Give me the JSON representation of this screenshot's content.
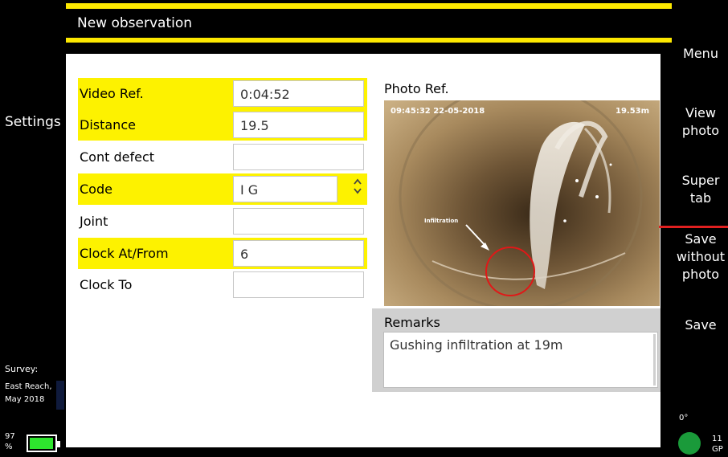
{
  "header": {
    "title": "New observation"
  },
  "left": {
    "settings_label": "Settings",
    "survey_label": "Survey:",
    "survey_name_line1": "East Reach,",
    "survey_name_line2": "May 2018",
    "battery_percent_line1": "97",
    "battery_percent_line2": "%",
    "battery_level": 0.97
  },
  "form": {
    "rows": [
      {
        "label": "Video Ref.",
        "value": "0:04:52",
        "highlighted": true
      },
      {
        "label": "Distance",
        "value": "19.5",
        "highlighted": true
      },
      {
        "label": "Cont defect",
        "value": "",
        "highlighted": false
      },
      {
        "label": "Code",
        "value": "I G",
        "highlighted": true
      },
      {
        "label": "Joint",
        "value": "",
        "highlighted": false
      },
      {
        "label": "Clock At/From",
        "value": "6",
        "highlighted": true
      },
      {
        "label": "Clock To",
        "value": "",
        "highlighted": false
      }
    ]
  },
  "photo": {
    "label": "Photo Ref.",
    "timestamp": "09:45:32 22-05-2018",
    "distance": "19.53m",
    "annotation": "Infiltration"
  },
  "remarks": {
    "label": "Remarks",
    "value": "Gushing infiltration at 19m"
  },
  "right_menu": {
    "menu": "Menu",
    "view_line1": "View",
    "view_line2": "photo",
    "super_line1": "Super",
    "super_line2": "tab",
    "save_without_line1": "Save",
    "save_without_line2": "without",
    "save_without_line3": "photo",
    "save": "Save",
    "degree": "0°",
    "gps_line1": "11",
    "gps_line2": "GP"
  },
  "colors": {
    "highlight": "#fdf200",
    "accent_bar": "#fde800",
    "battery": "#2ee42e",
    "gps": "#1a9a3a"
  }
}
